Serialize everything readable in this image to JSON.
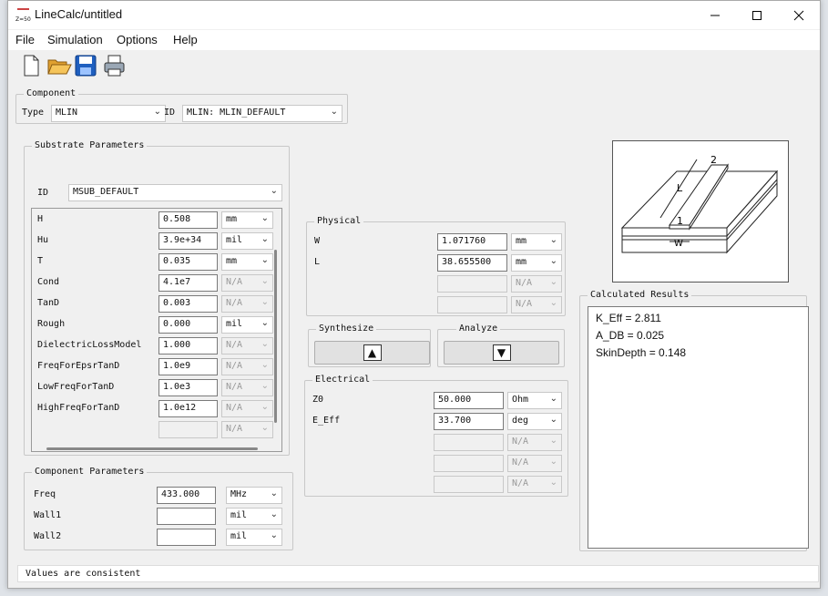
{
  "window": {
    "title": "LineCalc/untitled",
    "icon_text": "Z=50"
  },
  "menu": [
    "File",
    "Simulation",
    "Options",
    "Help"
  ],
  "component": {
    "title": "Component",
    "type_label": "Type",
    "type_value": "MLIN",
    "id_label": "ID",
    "id_value": "MLIN: MLIN_DEFAULT"
  },
  "substrate": {
    "title": "Substrate Parameters",
    "id_label": "ID",
    "id_value": "MSUB_DEFAULT",
    "params": [
      {
        "name": "H",
        "value": "0.508",
        "unit": "mm",
        "enabled": true
      },
      {
        "name": "Hu",
        "value": "3.9e+34",
        "unit": "mil",
        "enabled": true
      },
      {
        "name": "T",
        "value": "0.035",
        "unit": "mm",
        "enabled": true
      },
      {
        "name": "Cond",
        "value": "4.1e7",
        "unit": "N/A",
        "enabled": false
      },
      {
        "name": "TanD",
        "value": "0.003",
        "unit": "N/A",
        "enabled": false
      },
      {
        "name": "Rough",
        "value": "0.000",
        "unit": "mil",
        "enabled": true
      },
      {
        "name": "DielectricLossModel",
        "value": "1.000",
        "unit": "N/A",
        "enabled": false
      },
      {
        "name": "FreqForEpsrTanD",
        "value": "1.0e9",
        "unit": "N/A",
        "enabled": false
      },
      {
        "name": "LowFreqForTanD",
        "value": "1.0e3",
        "unit": "N/A",
        "enabled": false
      },
      {
        "name": "HighFreqForTanD",
        "value": "1.0e12",
        "unit": "N/A",
        "enabled": false
      },
      {
        "name": "",
        "value": "",
        "unit": "N/A",
        "enabled": false
      }
    ]
  },
  "component_params": {
    "title": "Component Parameters",
    "params": [
      {
        "name": "Freq",
        "value": "433.000",
        "unit": "MHz"
      },
      {
        "name": "Wall1",
        "value": "",
        "unit": "mil"
      },
      {
        "name": "Wall2",
        "value": "",
        "unit": "mil"
      }
    ]
  },
  "physical": {
    "title": "Physical",
    "params": [
      {
        "name": "W",
        "value": "1.071760",
        "unit": "mm",
        "enabled": true
      },
      {
        "name": "L",
        "value": "38.655500",
        "unit": "mm",
        "enabled": true
      },
      {
        "name": "",
        "value": "",
        "unit": "N/A",
        "enabled": false
      },
      {
        "name": "",
        "value": "",
        "unit": "N/A",
        "enabled": false
      }
    ]
  },
  "synthesize": {
    "title": "Synthesize",
    "arrow": "▲"
  },
  "analyze": {
    "title": "Analyze",
    "arrow": "▼"
  },
  "electrical": {
    "title": "Electrical",
    "params": [
      {
        "name": "Z0",
        "value": "50.000",
        "unit": "Ohm",
        "enabled": true
      },
      {
        "name": "E_Eff",
        "value": "33.700",
        "unit": "deg",
        "enabled": true
      },
      {
        "name": "",
        "value": "",
        "unit": "N/A",
        "enabled": false
      },
      {
        "name": "",
        "value": "",
        "unit": "N/A",
        "enabled": false
      },
      {
        "name": "",
        "value": "",
        "unit": "N/A",
        "enabled": false
      }
    ]
  },
  "diagram": {
    "port1": "1",
    "port2": "2",
    "length_label": "L",
    "width_label": "W"
  },
  "results": {
    "title": "Calculated Results",
    "lines": [
      "K_Eff = 2.811",
      "A_DB = 0.025",
      "SkinDepth = 0.148"
    ]
  },
  "status": "Values are consistent"
}
